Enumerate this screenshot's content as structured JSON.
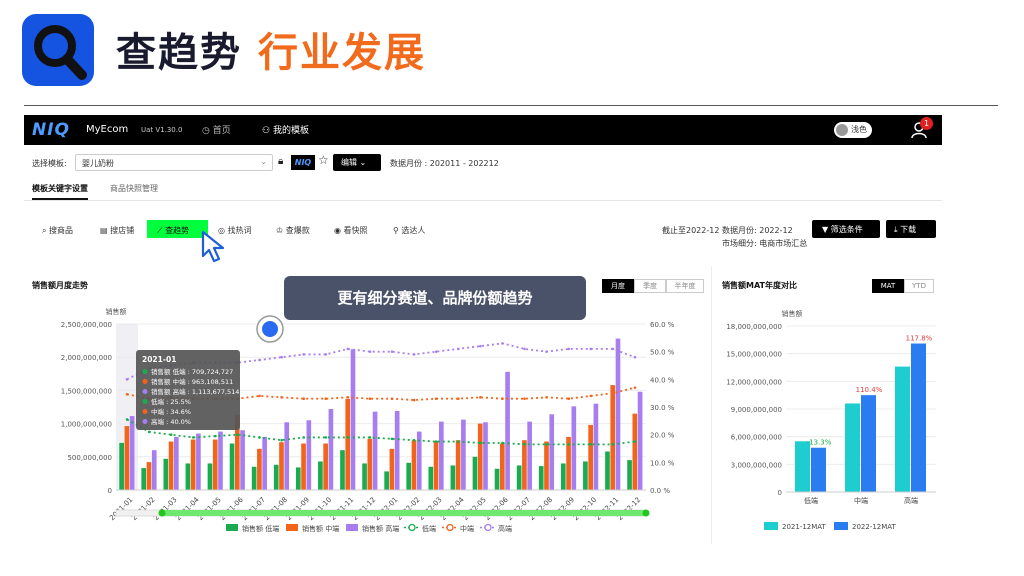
{
  "slide": {
    "title_main": "查趋势",
    "title_accent": "行业发展"
  },
  "topbar": {
    "brand": "NIQ",
    "app_name": "MyEcom",
    "version": "Uat V1.30.0",
    "nav": [
      {
        "label": "首页",
        "icon": "clock-icon"
      },
      {
        "label": "我的模板",
        "icon": "sitemap-icon"
      }
    ],
    "theme_toggle": "浅色",
    "notifications": "1"
  },
  "template_bar": {
    "label": "选择模板:",
    "selected": "婴儿奶粉",
    "niq": "NIQ",
    "edit": "编辑",
    "months": "数据月份 : 202011 - 202212"
  },
  "subtabs": [
    "模板关键字设置",
    "商品快照管理"
  ],
  "tools": [
    "搜商品",
    "搜店铺",
    "查趋势",
    "找热词",
    "查爆款",
    "看快照",
    "选达人"
  ],
  "info": {
    "cutoff": "截止至2022-12",
    "data_month": "数据月份: 2022-12",
    "market": "市场细分: 电商市场汇总"
  },
  "buttons": {
    "filter": "筛选条件",
    "download": "下载"
  },
  "callout": "更有细分赛道、品牌份额趋势",
  "colors": {
    "low": "#1aab4e",
    "mid": "#f2641c",
    "high": "#a77ef0",
    "mat2021": "#1ecdd0",
    "mat2022": "#2a7df0",
    "accent": "#f26b1d"
  },
  "chart_data": [
    {
      "type": "bar",
      "title": "销售额月度走势",
      "ylabel": "销售额",
      "ylim": [
        0,
        2500000000
      ],
      "y2lim": [
        0,
        60
      ],
      "yticks": [
        "2,500,000,000",
        "2,000,000,000",
        "1,500,000,000",
        "1,000,000,000",
        "500,000,000",
        "0"
      ],
      "y2ticks": [
        "60.0 %",
        "50.0 %",
        "40.0 %",
        "30.0 %",
        "20.0 %",
        "10.0 %",
        "0.0 %"
      ],
      "periods": [
        "月度",
        "季度",
        "半年度"
      ],
      "categories": [
        "2021-01",
        "2021-02",
        "2021-03",
        "2021-04",
        "2021-05",
        "2021-06",
        "2021-07",
        "2021-08",
        "2021-09",
        "2021-10",
        "2021-11",
        "2021-12",
        "2022-01",
        "2022-02",
        "2022-03",
        "2022-04",
        "2022-05",
        "2022-06",
        "2022-07",
        "2022-08",
        "2022-09",
        "2022-10",
        "2022-11",
        "2022-12"
      ],
      "series": [
        {
          "name": "销售额 低端",
          "values": [
            709724727,
            330000000,
            470000000,
            400000000,
            400000000,
            700000000,
            350000000,
            380000000,
            340000000,
            430000000,
            600000000,
            400000000,
            280000000,
            410000000,
            350000000,
            370000000,
            500000000,
            320000000,
            370000000,
            360000000,
            400000000,
            430000000,
            580000000,
            450000000
          ]
        },
        {
          "name": "销售额 中端",
          "values": [
            963108511,
            420000000,
            730000000,
            760000000,
            760000000,
            1130000000,
            620000000,
            720000000,
            700000000,
            700000000,
            1370000000,
            770000000,
            620000000,
            750000000,
            740000000,
            750000000,
            1000000000,
            700000000,
            750000000,
            730000000,
            800000000,
            980000000,
            1580000000,
            1150000000
          ]
        },
        {
          "name": "销售额 高端",
          "values": [
            1113677514,
            600000000,
            800000000,
            850000000,
            880000000,
            900000000,
            800000000,
            1020000000,
            1050000000,
            1220000000,
            2120000000,
            1180000000,
            1190000000,
            880000000,
            1030000000,
            1060000000,
            1020000000,
            1780000000,
            1030000000,
            1140000000,
            1260000000,
            1300000000,
            2280000000,
            1480000000
          ]
        },
        {
          "name": "低端",
          "values": [
            25.5,
            21,
            20,
            19,
            19.5,
            20,
            19,
            18,
            19,
            19,
            19,
            19,
            18.5,
            18,
            17.5,
            17.5,
            17,
            17,
            16.5,
            16.5,
            16.5,
            16.5,
            16.5,
            17.5
          ]
        },
        {
          "name": "中端",
          "values": [
            34.6,
            33,
            33.5,
            33,
            33,
            33,
            34,
            33.5,
            33,
            33,
            33.5,
            33,
            33,
            32.5,
            33,
            33,
            33.5,
            33,
            33,
            33.5,
            33,
            34,
            35,
            37
          ]
        },
        {
          "name": "高端",
          "values": [
            40.0,
            44,
            45,
            46,
            46,
            46,
            47,
            48,
            49,
            49,
            51,
            50,
            50,
            49,
            50,
            51,
            52,
            53,
            51,
            50,
            51,
            51,
            51,
            48
          ]
        }
      ],
      "legend": [
        "销售额 低端",
        "销售额 中端",
        "销售额 高端",
        "低端",
        "中端",
        "高端"
      ],
      "legend_position": "bottom",
      "tooltip": {
        "title": "2021-01",
        "rows": [
          "销售额 低端 : 709,724,727",
          "销售额 中端 : 963,108,511",
          "销售额 高端 : 1,113,677,514",
          "低端 : 25.5%",
          "中端 : 34.6%",
          "高端 : 40.0%"
        ]
      }
    },
    {
      "type": "bar",
      "title": "销售额MAT年度对比",
      "ylabel": "销售额",
      "ylim": [
        0,
        18000000000
      ],
      "yticks": [
        "18,000,000,000",
        "15,000,000,000",
        "12,000,000,000",
        "9,000,000,000",
        "6,000,000,000",
        "3,000,000,000",
        "0"
      ],
      "toggles": [
        "MAT",
        "YTD"
      ],
      "categories": [
        "低端",
        "中端",
        "高端"
      ],
      "series": [
        {
          "name": "2021-12MAT",
          "values": [
            5500000000,
            9600000000,
            13600000000
          ]
        },
        {
          "name": "2022-12MAT",
          "values": [
            4800000000,
            10500000000,
            16100000000
          ]
        }
      ],
      "growth_labels": [
        "-13.3%",
        "110.4%",
        "117.8%"
      ],
      "legend_position": "bottom"
    }
  ]
}
